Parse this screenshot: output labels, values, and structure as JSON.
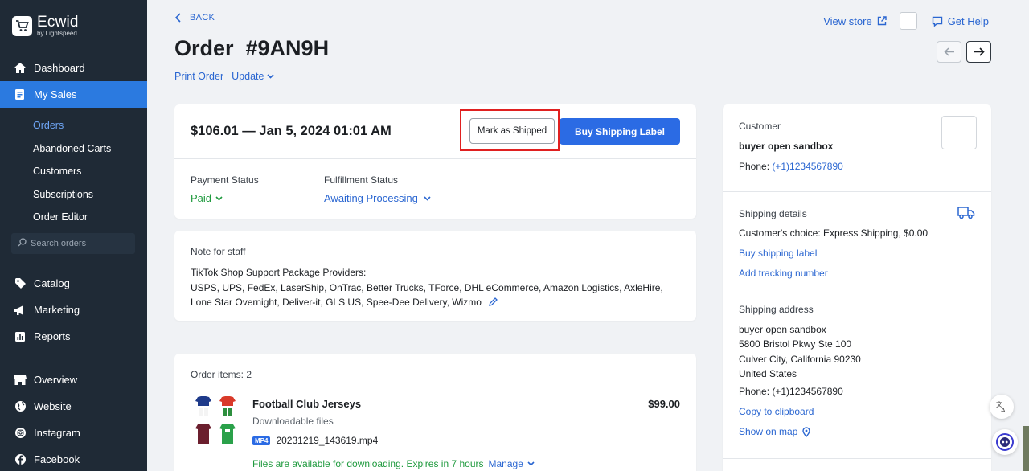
{
  "brand": {
    "name": "Ecwid",
    "sub": "by Lightspeed"
  },
  "sidebar": {
    "items": [
      {
        "label": "Dashboard"
      },
      {
        "label": "My Sales"
      },
      {
        "label": "Catalog"
      },
      {
        "label": "Marketing"
      },
      {
        "label": "Reports"
      },
      {
        "label": "Overview"
      },
      {
        "label": "Website"
      },
      {
        "label": "Instagram"
      },
      {
        "label": "Facebook"
      }
    ],
    "sales_sub": [
      "Orders",
      "Abandoned Carts",
      "Customers",
      "Subscriptions",
      "Order Editor"
    ],
    "search_placeholder": "Search orders"
  },
  "header": {
    "back": "BACK",
    "title": "Order  #9AN9H",
    "print": "Print Order",
    "update": "Update",
    "view_store": "View store",
    "get_help": "Get Help"
  },
  "summary": {
    "headline": "$106.01 — Jan 5, 2024 01:01 AM",
    "mark_shipped": "Mark as Shipped",
    "buy_label": "Buy Shipping Label",
    "payment_label": "Payment Status",
    "payment_value": "Paid",
    "fulfillment_label": "Fulfillment Status",
    "fulfillment_value": "Awaiting Processing"
  },
  "note": {
    "title": "Note for staff",
    "line1": "TikTok Shop Support Package Providers:",
    "line2": "USPS, UPS, FedEx, LaserShip, OnTrac, Better Trucks, TForce, DHL eCommerce, Amazon Logistics, AxleHire, Lone Star Overnight, Deliver-it, GLS US, Spee-Dee Delivery, Wizmo"
  },
  "items": {
    "title": "Order items: 2",
    "name": "Football Club Jerseys",
    "price": "$99.00",
    "sub": "Downloadable files",
    "file_badge": "MP4",
    "file_name": "20231219_143619.mp4",
    "availability": "Files are available for downloading. Expires in 7 hours",
    "manage": "Manage"
  },
  "customer": {
    "title": "Customer",
    "name": "buyer open sandbox",
    "phone_label": "Phone: ",
    "phone": "(+1)1234567890"
  },
  "shipping": {
    "title": "Shipping details",
    "choice": "Customer's choice: Express Shipping, $0.00",
    "buy_label": "Buy shipping label",
    "add_tracking": "Add tracking number"
  },
  "address": {
    "title": "Shipping address",
    "name": "buyer open sandbox",
    "street": "5800 Bristol Pkwy Ste 100",
    "city": "Culver City, California 90230",
    "country": "United States",
    "phone": "Phone: (+1)1234567890",
    "copy": "Copy to clipboard",
    "map": "Show on map"
  },
  "colors": {
    "accent": "#2b6be4",
    "sidebar": "#1f2a36",
    "active_nav": "#2b7ae0",
    "paid": "#1f9a3e",
    "highlight": "#e02020"
  }
}
